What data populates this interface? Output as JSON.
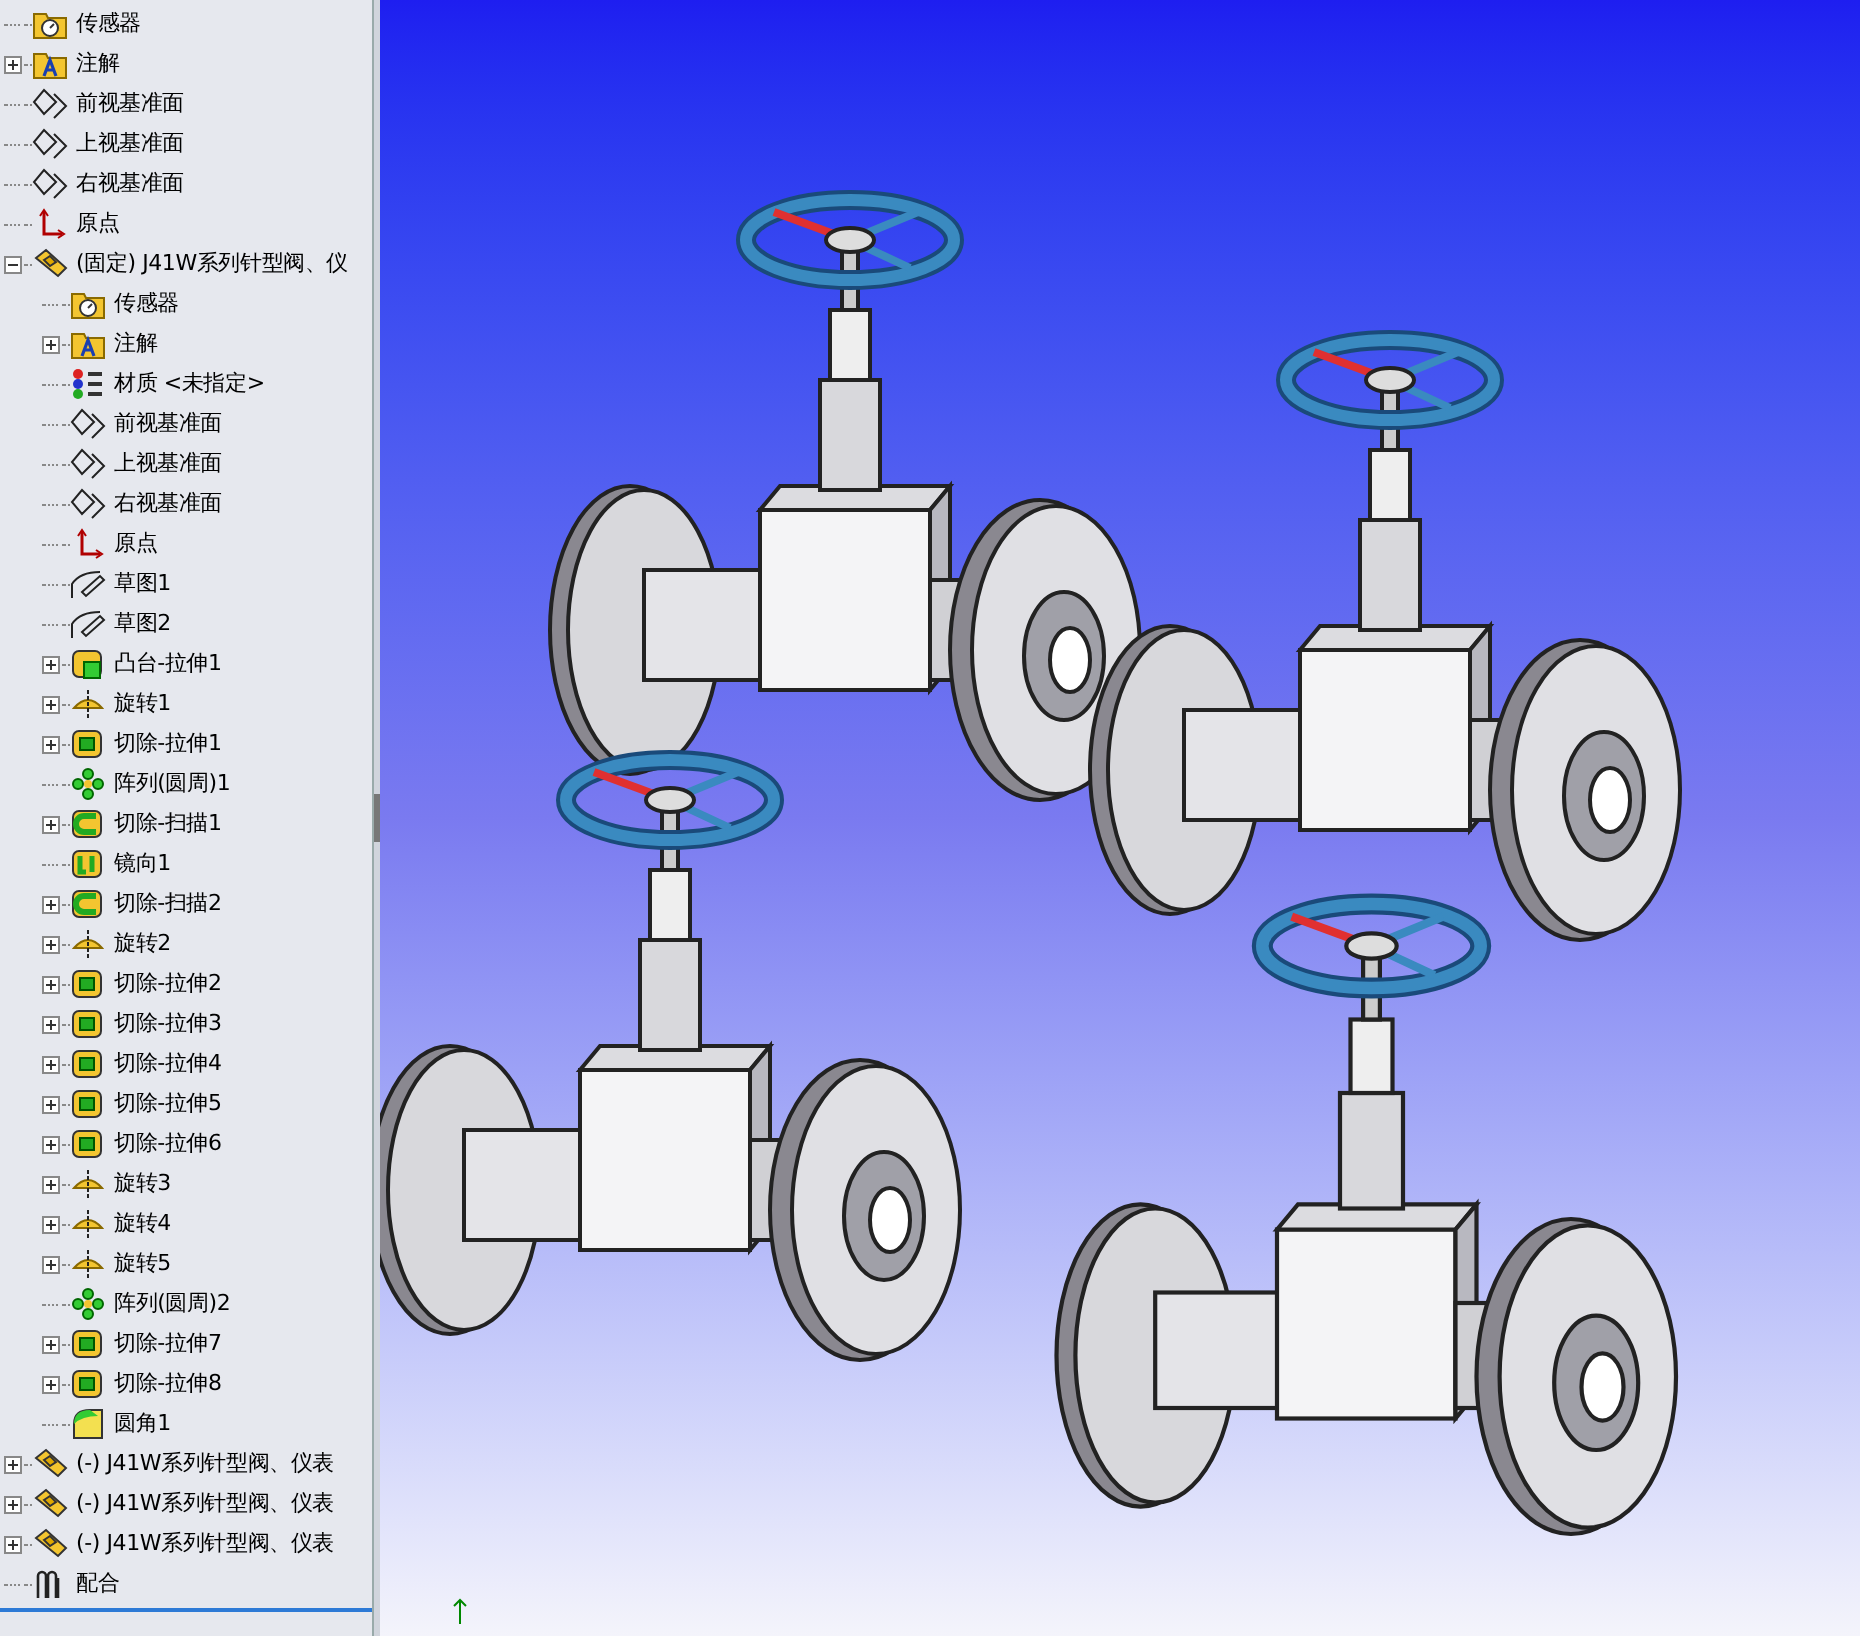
{
  "tree": [
    {
      "label": "传感器",
      "kind": "sensor"
    },
    {
      "label": "注解",
      "kind": "annotation",
      "expanded": false
    },
    {
      "label": "前视基准面",
      "kind": "plane"
    },
    {
      "label": "上视基准面",
      "kind": "plane"
    },
    {
      "label": "右视基准面",
      "kind": "plane"
    },
    {
      "label": "原点",
      "kind": "origin"
    },
    {
      "label": "(固定) J41W系列针型阀、仪",
      "kind": "part",
      "expanded": true,
      "children": [
        {
          "label": "传感器",
          "kind": "sensor"
        },
        {
          "label": "注解",
          "kind": "annotation",
          "expanded": false
        },
        {
          "label": "材质 <未指定>",
          "kind": "material"
        },
        {
          "label": "前视基准面",
          "kind": "plane"
        },
        {
          "label": "上视基准面",
          "kind": "plane"
        },
        {
          "label": "右视基准面",
          "kind": "plane"
        },
        {
          "label": "原点",
          "kind": "origin"
        },
        {
          "label": "草图1",
          "kind": "sketch"
        },
        {
          "label": "草图2",
          "kind": "sketch"
        },
        {
          "label": "凸台-拉伸1",
          "kind": "boss",
          "expanded": false
        },
        {
          "label": "旋转1",
          "kind": "revolve",
          "expanded": false
        },
        {
          "label": "切除-拉伸1",
          "kind": "cut",
          "expanded": false
        },
        {
          "label": "阵列(圆周)1",
          "kind": "pattern"
        },
        {
          "label": "切除-扫描1",
          "kind": "sweep",
          "expanded": false
        },
        {
          "label": "镜向1",
          "kind": "mirror"
        },
        {
          "label": "切除-扫描2",
          "kind": "sweep",
          "expanded": false
        },
        {
          "label": "旋转2",
          "kind": "revolve",
          "expanded": false
        },
        {
          "label": "切除-拉伸2",
          "kind": "cut",
          "expanded": false
        },
        {
          "label": "切除-拉伸3",
          "kind": "cut",
          "expanded": false
        },
        {
          "label": "切除-拉伸4",
          "kind": "cut",
          "expanded": false
        },
        {
          "label": "切除-拉伸5",
          "kind": "cut",
          "expanded": false
        },
        {
          "label": "切除-拉伸6",
          "kind": "cut",
          "expanded": false
        },
        {
          "label": "旋转3",
          "kind": "revolve",
          "expanded": false
        },
        {
          "label": "旋转4",
          "kind": "revolve",
          "expanded": false
        },
        {
          "label": "旋转5",
          "kind": "revolve",
          "expanded": false
        },
        {
          "label": "阵列(圆周)2",
          "kind": "pattern"
        },
        {
          "label": "切除-拉伸7",
          "kind": "cut",
          "expanded": false
        },
        {
          "label": "切除-拉伸8",
          "kind": "cut",
          "expanded": false
        },
        {
          "label": "圆角1",
          "kind": "fillet"
        }
      ]
    },
    {
      "label": "(-) J41W系列针型阀、仪表",
      "kind": "part",
      "expanded": false
    },
    {
      "label": "(-) J41W系列针型阀、仪表",
      "kind": "part",
      "expanded": false
    },
    {
      "label": "(-) J41W系列针型阀、仪表",
      "kind": "part",
      "expanded": false
    },
    {
      "label": "配合",
      "kind": "mates"
    }
  ]
}
